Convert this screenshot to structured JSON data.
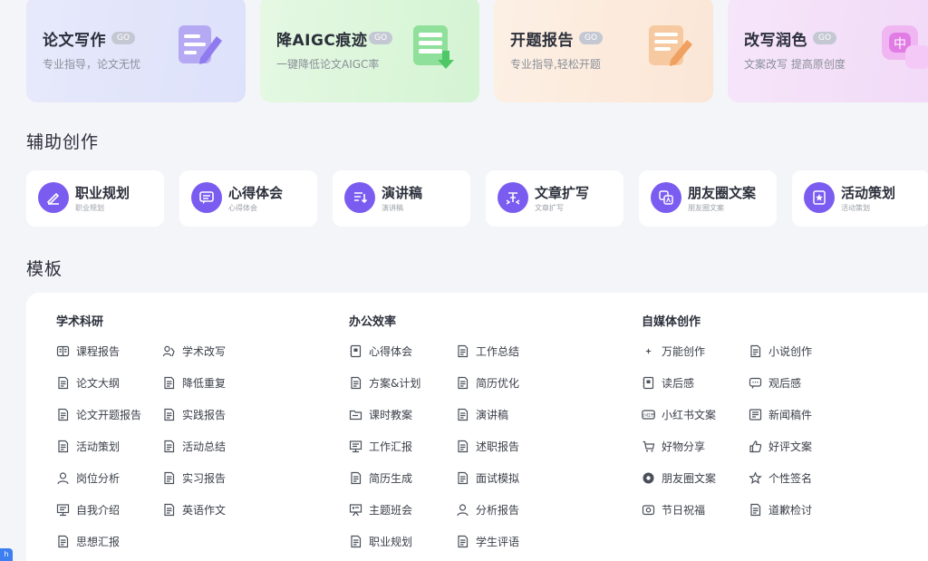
{
  "features": [
    {
      "title": "论文写作",
      "go": "GO",
      "subtitle": "专业指导，论文无忧",
      "icon": "document-pen-icon"
    },
    {
      "title": "降AIGC痕迹",
      "go": "GO",
      "subtitle": "一键降低论文AIGC率",
      "icon": "table-arrow-icon"
    },
    {
      "title": "开题报告",
      "go": "GO",
      "subtitle": "专业指导,轻松开题",
      "icon": "report-pen-icon"
    },
    {
      "title": "改写润色",
      "go": "GO",
      "subtitle": "文案改写 提高原创度",
      "icon": "translate-bubble-icon"
    }
  ],
  "aux_section_title": "辅助创作",
  "aux_tools": [
    {
      "title": "职业规划",
      "subtitle": "职业规划",
      "icon": "pen-circle-icon"
    },
    {
      "title": "心得体会",
      "subtitle": "心得体会",
      "icon": "chat-lines-icon"
    },
    {
      "title": "演讲稿",
      "subtitle": "演讲稿",
      "icon": "list-down-icon"
    },
    {
      "title": "文章扩写",
      "subtitle": "文章扩写",
      "icon": "expand-text-icon"
    },
    {
      "title": "朋友圈文案",
      "subtitle": "朋友圈文案",
      "icon": "translate-icon"
    },
    {
      "title": "活动策划",
      "subtitle": "活动策划",
      "icon": "star-badge-icon"
    }
  ],
  "templates_section_title": "模板",
  "categories": [
    {
      "name": "学术科研",
      "items": [
        {
          "label": "课程报告",
          "icon": "book-icon"
        },
        {
          "label": "学术改写",
          "icon": "users-icon"
        },
        {
          "label": "论文大纲",
          "icon": "outline-icon"
        },
        {
          "label": "降低重复",
          "icon": "doc-edit-icon"
        },
        {
          "label": "论文开题报告",
          "icon": "doc-edit-icon"
        },
        {
          "label": "实践报告",
          "icon": "chart-doc-icon"
        },
        {
          "label": "活动策划",
          "icon": "award-doc-icon"
        },
        {
          "label": "活动总结",
          "icon": "clipboard-icon"
        },
        {
          "label": "岗位分析",
          "icon": "person-icon"
        },
        {
          "label": "实习报告",
          "icon": "doc-lines-icon"
        },
        {
          "label": "自我介绍",
          "icon": "presentation-icon"
        },
        {
          "label": "英语作文",
          "icon": "doc-pen-icon"
        },
        {
          "label": "思想汇报",
          "icon": "doc-person-icon"
        }
      ]
    },
    {
      "name": "办公效率",
      "items": [
        {
          "label": "心得体会",
          "icon": "notebook-icon"
        },
        {
          "label": "工作总结",
          "icon": "doc-search-icon"
        },
        {
          "label": "方案&计划",
          "icon": "doc-lines-icon"
        },
        {
          "label": "简历优化",
          "icon": "resume-icon"
        },
        {
          "label": "课时教案",
          "icon": "folder-icon"
        },
        {
          "label": "演讲稿",
          "icon": "mic-doc-icon"
        },
        {
          "label": "工作汇报",
          "icon": "presentation-icon"
        },
        {
          "label": "述职报告",
          "icon": "doc-edit-icon"
        },
        {
          "label": "简历生成",
          "icon": "doc-lines-icon"
        },
        {
          "label": "面试模拟",
          "icon": "interview-icon"
        },
        {
          "label": "主题班会",
          "icon": "board-icon"
        },
        {
          "label": "分析报告",
          "icon": "person-icon"
        },
        {
          "label": "职业规划",
          "icon": "doc-person-icon"
        },
        {
          "label": "学生评语",
          "icon": "doc-lines-icon"
        }
      ]
    },
    {
      "name": "自媒体创作",
      "items": [
        {
          "label": "万能创作",
          "icon": "sparkle-icon"
        },
        {
          "label": "小说创作",
          "icon": "book-pen-icon"
        },
        {
          "label": "读后感",
          "icon": "notebook-icon"
        },
        {
          "label": "观后感",
          "icon": "chat-icon"
        },
        {
          "label": "小红书文案",
          "icon": "xhs-icon"
        },
        {
          "label": "新闻稿件",
          "icon": "news-icon"
        },
        {
          "label": "好物分享",
          "icon": "cart-icon"
        },
        {
          "label": "好评文案",
          "icon": "thumbs-up-icon"
        },
        {
          "label": "朋友圈文案",
          "icon": "aperture-icon"
        },
        {
          "label": "个性签名",
          "icon": "star-outline-icon"
        },
        {
          "label": "节日祝福",
          "icon": "gift-icon"
        },
        {
          "label": "道歉检讨",
          "icon": "doc-person-icon"
        }
      ]
    }
  ],
  "colors": {
    "accent": "#7b5cf0",
    "text": "#2b2f3a",
    "muted": "#8a8f99"
  }
}
